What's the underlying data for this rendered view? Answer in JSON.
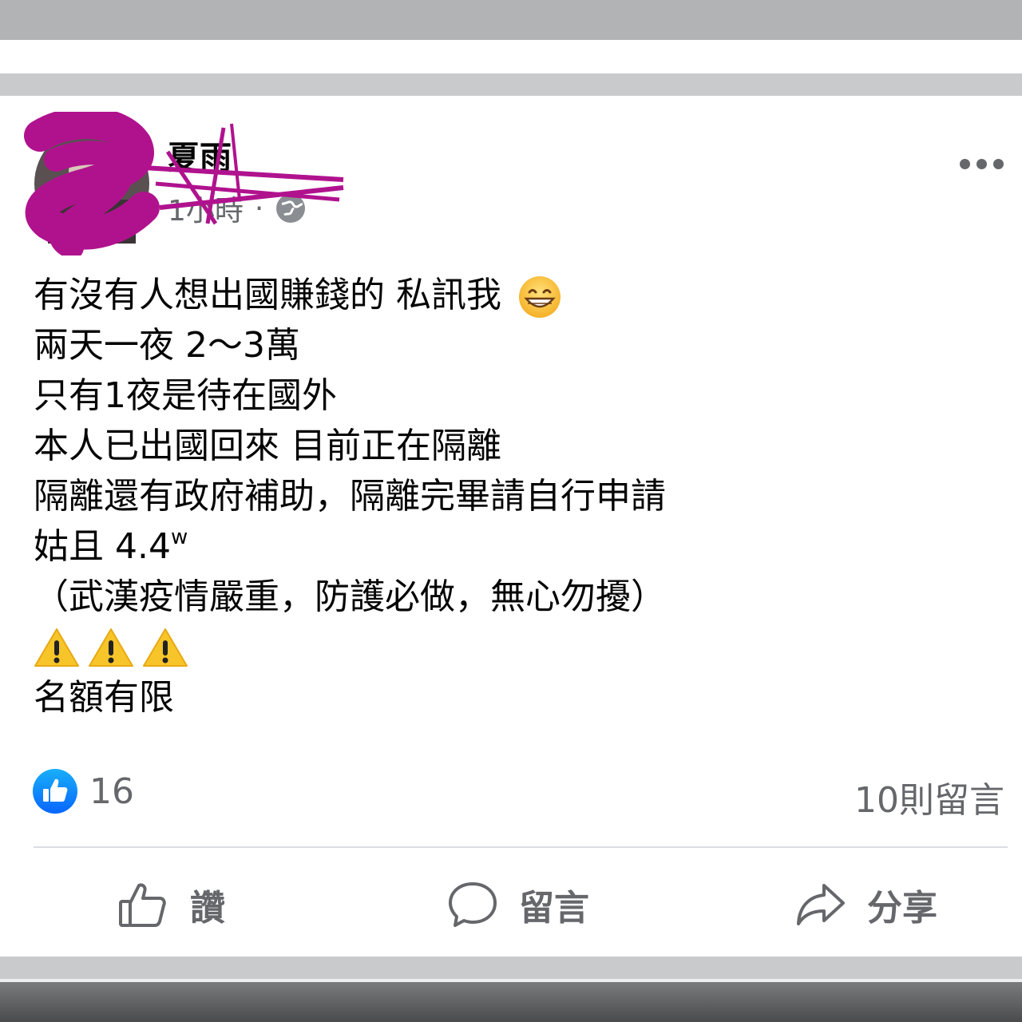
{
  "post": {
    "author": "夏雨",
    "time": "1小時",
    "separator": "·",
    "privacy_icon": "globe-icon",
    "lines": {
      "l1": "有沒有人想出國賺錢的 私訊我",
      "l2": "兩天一夜 2～3萬",
      "l3": "只有1夜是待在國外",
      "l4": "本人已出國回來 目前正在隔離",
      "l5": "隔離還有政府補助，隔離完畢請自行申請",
      "l6": "姑且 4.4",
      "l6_sup": "w",
      "l7": "（武漢疫情嚴重，防護必做，無心勿擾）",
      "l9": "名額有限"
    },
    "emoji": "grinning-face-icon",
    "warning_icons": [
      "warning-icon",
      "warning-icon",
      "warning-icon"
    ]
  },
  "reactions": {
    "like_icon": "like-badge-icon",
    "count": "16",
    "comments": "10則留言"
  },
  "actions": {
    "like_label": "讚",
    "comment_label": "留言",
    "share_label": "分享"
  },
  "colors": {
    "brand_blue": "#1877f2",
    "secondary_text": "#65676b",
    "scribble": "#b0128e"
  }
}
